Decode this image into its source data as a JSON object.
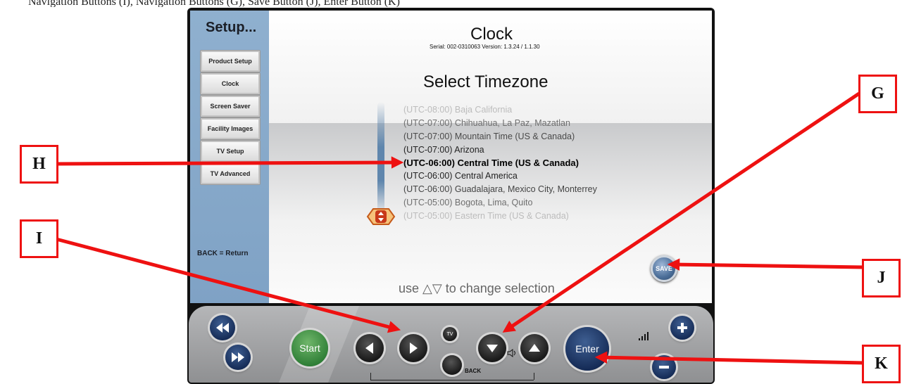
{
  "caption": "Navigation Buttons (I), Navigation Buttons (G), Save Button (J), Enter Button (K)",
  "sidebar": {
    "title": "Setup...",
    "items": [
      {
        "label": "Product Setup"
      },
      {
        "label": "Clock"
      },
      {
        "label": "Screen Saver"
      },
      {
        "label": "Facility Images"
      },
      {
        "label": "TV Setup"
      },
      {
        "label": "TV Advanced"
      }
    ],
    "back_hint": "BACK = Return"
  },
  "main": {
    "title": "Clock",
    "serial": "Serial: 002-0310063  Version: 1.3.24 / 1.1.30",
    "timezone_title": "Select Timezone",
    "timezones": [
      {
        "label": "(UTC-08:00) Baja California"
      },
      {
        "label": "(UTC-07:00) Chihuahua, La Paz, Mazatlan"
      },
      {
        "label": "(UTC-07:00) Mountain Time (US & Canada)"
      },
      {
        "label": "(UTC-07:00) Arizona"
      },
      {
        "label": "(UTC-06:00) Central Time (US & Canada)"
      },
      {
        "label": "(UTC-06:00) Central America"
      },
      {
        "label": "(UTC-06:00) Guadalajara, Mexico City, Monterrey"
      },
      {
        "label": "(UTC-05:00) Bogota, Lima, Quito"
      },
      {
        "label": "(UTC-05:00) Eastern Time (US & Canada)"
      }
    ],
    "selected_index": 4,
    "change_hint": "use △▽ to change selection",
    "save_label": "SAVE"
  },
  "controls": {
    "start_label": "Start",
    "enter_label": "Enter",
    "back_label": "BACK",
    "tv_label": "TV"
  },
  "annotations": [
    {
      "letter": "H"
    },
    {
      "letter": "I"
    },
    {
      "letter": "G"
    },
    {
      "letter": "J"
    },
    {
      "letter": "K"
    }
  ],
  "colors": {
    "sidebar": "#7fa2c5",
    "annotation_red": "#ee1111",
    "start_green": "#2d7d35",
    "navy": "#142a55"
  }
}
